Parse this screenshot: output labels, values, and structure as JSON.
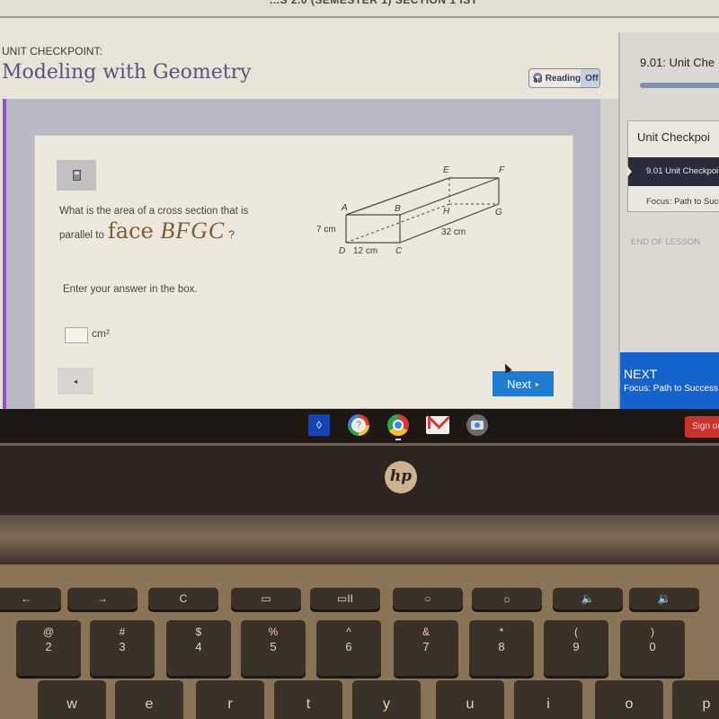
{
  "browser": {
    "top_strip_text": "...S 2.0 (SEMESTER 1) SECTION 1 IST"
  },
  "lesson": {
    "label": "UNIT CHECKPOINT:",
    "title": "Modeling with Geometry",
    "reading_toggle": {
      "label": "Reading",
      "state": "Off",
      "icon": "headphones-icon"
    }
  },
  "question": {
    "calculator_icon": "calculator-icon",
    "text_line1": "What is the area of a cross section that is",
    "text_line2_prefix": "parallel to",
    "face_word": "face",
    "face_name": "BFGC",
    "question_mark": "?",
    "figure": {
      "vertices": [
        "A",
        "B",
        "C",
        "D",
        "E",
        "F",
        "G",
        "H"
      ],
      "dimensions": {
        "height": "7 cm",
        "width": "12 cm",
        "length": "32 cm"
      }
    },
    "instruction": "Enter your answer in the box.",
    "answer_value": "",
    "answer_unit": "cm²"
  },
  "navigation": {
    "back_icon": "◂",
    "next_label": "Next",
    "next_icon": "▸"
  },
  "sidebar": {
    "title": "9.01: Unit Che",
    "progress": 0.9,
    "card_title": "Unit Checkpoi",
    "items": [
      {
        "label": "9.01 Unit Checkpoi",
        "active": true
      },
      {
        "label": "Focus: Path to Succe",
        "active": false
      }
    ],
    "end_label": "END OF LESSON",
    "next_panel": {
      "heading": "NEXT",
      "subtitle": "Focus: Path to Success"
    }
  },
  "shelf": {
    "apps": [
      "launcher-icon",
      "help-icon",
      "chrome-icon",
      "gmail-icon",
      "camera-icon"
    ],
    "help_glyph": "?",
    "launcher_glyph": "◊",
    "signout_label": "Sign ou"
  },
  "laptop": {
    "logo": "hp",
    "function_keys": [
      "←",
      "→",
      "C",
      "▭",
      "▭II",
      "○",
      "☼",
      "🔈",
      "🔉"
    ],
    "number_keys": [
      {
        "top": "@",
        "bottom": "2"
      },
      {
        "top": "#",
        "bottom": "3"
      },
      {
        "top": "$",
        "bottom": "4"
      },
      {
        "top": "%",
        "bottom": "5"
      },
      {
        "top": "^",
        "bottom": "6"
      },
      {
        "top": "&",
        "bottom": "7"
      },
      {
        "top": "*",
        "bottom": "8"
      },
      {
        "top": "(",
        "bottom": "9"
      },
      {
        "top": ")",
        "bottom": "0"
      }
    ],
    "letter_keys": [
      "w",
      "e",
      "r",
      "t",
      "y",
      "u",
      "i",
      "o",
      "p"
    ]
  },
  "colors": {
    "accent_purple": "#9a4fc4",
    "next_blue": "#1e7cd2",
    "panel_next_blue": "#1463cc",
    "title_color": "#56547c",
    "signout_red": "#c8342b"
  }
}
